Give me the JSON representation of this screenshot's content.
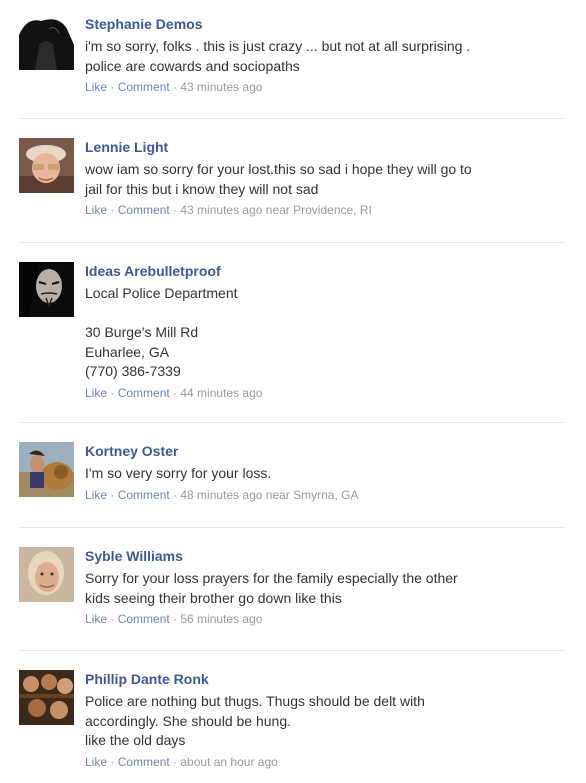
{
  "comments": [
    {
      "name": "Stephanie Demos",
      "text": "i'm so sorry, folks . this is just crazy ... but not at all surprising .\npolice are cowards and sociopaths",
      "like": "Like",
      "comment": "Comment",
      "time": "43 minutes ago",
      "location": ""
    },
    {
      "name": "Lennie Light",
      "text": "wow iam so sorry for your lost.this so sad i hope they will go to\njail for this but i know they will not sad",
      "like": "Like",
      "comment": "Comment",
      "time": "43 minutes ago",
      "location": "near Providence, RI"
    },
    {
      "name": "Ideas Arebulletproof",
      "text": "Local Police Department\n\n30 Burge's Mill Rd\nEuharlee, GA\n(770) 386-7339",
      "like": "Like",
      "comment": "Comment",
      "time": "44 minutes ago",
      "location": ""
    },
    {
      "name": "Kortney Oster",
      "text": "I'm so very sorry for your loss.",
      "like": "Like",
      "comment": "Comment",
      "time": "48 minutes ago",
      "location": "near Smyrna, GA"
    },
    {
      "name": "Syble Williams",
      "text": "Sorry for your loss prayers for the family especially the other\nkids seeing their brother go down like this",
      "like": "Like",
      "comment": "Comment",
      "time": "56 minutes ago",
      "location": ""
    },
    {
      "name": "Phillip Dante Ronk",
      "text": "Police are nothing but thugs. Thugs should be delt with\naccordingly. She should be hung.\nlike the old days",
      "like": "Like",
      "comment": "Comment",
      "time": "about an hour ago",
      "location": ""
    }
  ],
  "separator": " · "
}
